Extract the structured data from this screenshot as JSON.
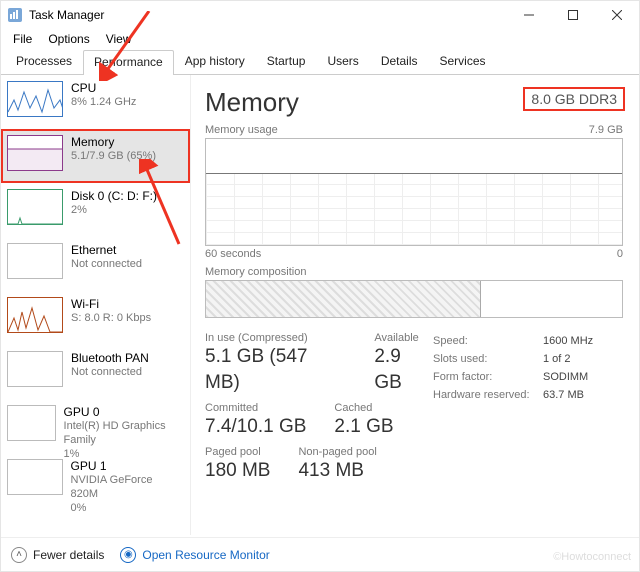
{
  "window": {
    "title": "Task Manager"
  },
  "menus": {
    "file": "File",
    "options": "Options",
    "view": "View"
  },
  "tabs": [
    {
      "label": "Processes",
      "active": false
    },
    {
      "label": "Performance",
      "active": true
    },
    {
      "label": "App history",
      "active": false
    },
    {
      "label": "Startup",
      "active": false
    },
    {
      "label": "Users",
      "active": false
    },
    {
      "label": "Details",
      "active": false
    },
    {
      "label": "Services",
      "active": false
    }
  ],
  "sidebar": [
    {
      "title": "CPU",
      "sub": "8%  1.24 GHz"
    },
    {
      "title": "Memory",
      "sub": "5.1/7.9 GB (65%)"
    },
    {
      "title": "Disk 0 (C: D: F:)",
      "sub": "2%"
    },
    {
      "title": "Ethernet",
      "sub": "Not connected"
    },
    {
      "title": "Wi-Fi",
      "sub": "S: 8.0 R: 0 Kbps"
    },
    {
      "title": "Bluetooth PAN",
      "sub": "Not connected"
    },
    {
      "title": "GPU 0",
      "sub": "Intel(R) HD Graphics Family\n1%"
    },
    {
      "title": "GPU 1",
      "sub": "NVIDIA GeForce 820M\n0%"
    }
  ],
  "main": {
    "heading": "Memory",
    "spec": "8.0 GB DDR3",
    "usage_label": "Memory usage",
    "usage_max": "7.9 GB",
    "x_left": "60 seconds",
    "x_right": "0",
    "comp_label": "Memory composition",
    "stats": {
      "in_use_label": "In use (Compressed)",
      "in_use_value": "5.1 GB (547 MB)",
      "available_label": "Available",
      "available_value": "2.9 GB",
      "committed_label": "Committed",
      "committed_value": "7.4/10.1 GB",
      "cached_label": "Cached",
      "cached_value": "2.1 GB",
      "paged_label": "Paged pool",
      "paged_value": "180 MB",
      "nonpaged_label": "Non-paged pool",
      "nonpaged_value": "413 MB"
    },
    "right_stats": [
      {
        "k": "Speed:",
        "v": "1600 MHz"
      },
      {
        "k": "Slots used:",
        "v": "1 of 2"
      },
      {
        "k": "Form factor:",
        "v": "SODIMM"
      },
      {
        "k": "Hardware reserved:",
        "v": "63.7 MB"
      }
    ]
  },
  "bottom": {
    "fewer": "Fewer details",
    "resmon": "Open Resource Monitor"
  },
  "watermark": "©Howtoconnect",
  "chart_data": {
    "type": "area",
    "title": "Memory usage",
    "x": [
      60,
      0
    ],
    "xlabel": "seconds",
    "ylabel": "GB",
    "ylim": [
      0,
      7.9
    ],
    "series": [
      {
        "name": "Memory",
        "values": [
          5.1,
          5.1
        ]
      }
    ]
  }
}
